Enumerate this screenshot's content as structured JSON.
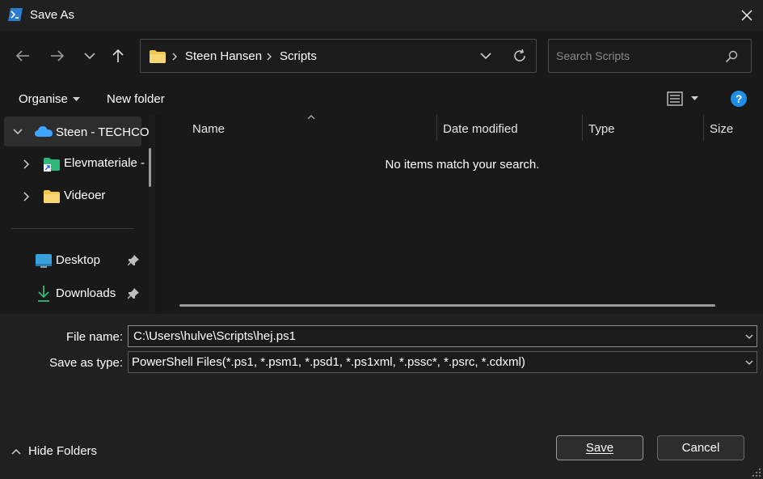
{
  "window": {
    "title": "Save As"
  },
  "address": {
    "crumbs": [
      "Steen Hansen",
      "Scripts"
    ]
  },
  "search": {
    "placeholder": "Search Scripts"
  },
  "toolbar": {
    "organise_label": "Organise",
    "new_folder_label": "New folder"
  },
  "nav_pane": {
    "items": [
      {
        "label": "Steen - TECHCO",
        "icon": "onedrive-cloud-icon"
      },
      {
        "label": "Elevmateriale -",
        "icon": "shared-folder-icon"
      },
      {
        "label": "Videoer",
        "icon": "folder-icon"
      },
      {
        "label": "Desktop",
        "icon": "desktop-icon"
      },
      {
        "label": "Downloads",
        "icon": "download-icon"
      }
    ]
  },
  "file_list": {
    "columns": [
      "Name",
      "Date modified",
      "Type",
      "Size"
    ],
    "empty_message": "No items match your search."
  },
  "form": {
    "file_name_label": "File name:",
    "file_name_value": "C:\\Users\\hulve\\Scripts\\hej.ps1",
    "save_type_label": "Save as type:",
    "save_type_value": "PowerShell Files(*.ps1, *.psm1, *.psd1, *.ps1xml, *.pssc*, *.psrc, *.cdxml)"
  },
  "footer": {
    "hide_folders_label": "Hide Folders",
    "save_label": "Save",
    "cancel_label": "Cancel"
  },
  "colors": {
    "folder_yellow": "#f2c94c",
    "onedrive_blue": "#3ea6ff",
    "help_blue": "#1f8ce6",
    "accent_green": "#2fb87a"
  }
}
